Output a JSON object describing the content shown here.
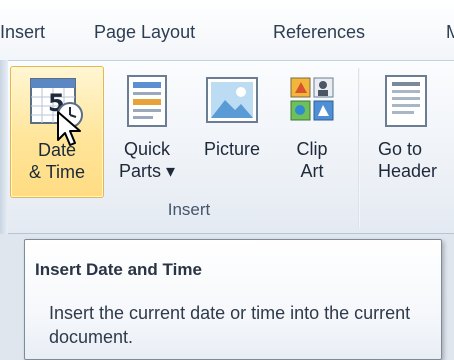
{
  "tabs": [
    {
      "label": "Insert"
    },
    {
      "label": "Page Layout"
    },
    {
      "label": "References"
    },
    {
      "label": "Mailings"
    }
  ],
  "ribbon": {
    "group_label": "Insert",
    "buttons": {
      "date_time": {
        "line1": "Date",
        "line2": "& Time",
        "icon": "calendar-clock-icon"
      },
      "quick_parts": {
        "line1": "Quick",
        "line2": "Parts ▾",
        "icon": "quick-parts-icon"
      },
      "picture": {
        "line1": "Picture",
        "line2": "",
        "icon": "picture-icon"
      },
      "clip_art": {
        "line1": "Clip",
        "line2": "Art",
        "icon": "clip-art-icon"
      },
      "header": {
        "line1": "Go to",
        "line2": "Header",
        "icon": "header-page-icon"
      }
    }
  },
  "tooltip": {
    "title": "Insert Date and Time",
    "description": "Insert the current date or time into the current document."
  },
  "colors": {
    "hover_fill": "#ffe59a",
    "hover_border": "#e5b944",
    "ribbon_bg": "#eef2f7"
  }
}
